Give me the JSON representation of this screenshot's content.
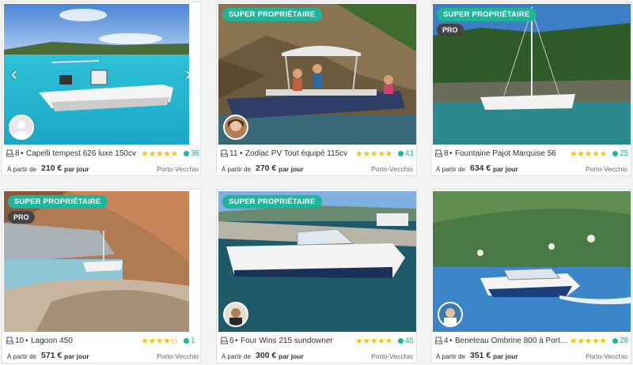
{
  "listings": [
    {
      "capacity": "8",
      "name": "Capelli tempest 626 luxe 150cv",
      "stars": "★★★★★",
      "reviews": "38",
      "price_prefix": "À partir de",
      "price": "210 €",
      "price_suffix": "par jour",
      "city": "Porto-Vecchio",
      "super": "",
      "pro": "",
      "nav_prev": "‹",
      "nav_next": "›"
    },
    {
      "capacity": "11",
      "name": "Zodiac PV Tout équipé 115cv",
      "stars": "★★★★★",
      "reviews": "41",
      "price_prefix": "À partir de",
      "price": "270 €",
      "price_suffix": "par jour",
      "city": "Porto-Vecchio",
      "super": "SUPER PROPRIÉTAIRE",
      "pro": ""
    },
    {
      "capacity": "8",
      "name": "Fountaine Pajot Marquise 56",
      "stars": "★★★★★",
      "reviews": "25",
      "price_prefix": "À partir de",
      "price": "634 €",
      "price_suffix": "par jour",
      "city": "Porto-Vecchio",
      "super": "SUPER PROPRIÉTAIRE",
      "pro": "PRO"
    },
    {
      "capacity": "10",
      "name": "Lagoon 450",
      "stars": "★★★★½",
      "reviews": "1",
      "price_prefix": "À partir de",
      "price": "571 €",
      "price_suffix": "par jour",
      "city": "Porto-Vecchio",
      "super": "SUPER PROPRIÉTAIRE",
      "pro": "PRO"
    },
    {
      "capacity": "6",
      "name": "Four Wins 215 sundowner",
      "stars": "★★★★★",
      "reviews": "45",
      "price_prefix": "À partir de",
      "price": "300 €",
      "price_suffix": "par jour",
      "city": "Porto-Vecchio",
      "super": "SUPER PROPRIÉTAIRE",
      "pro": ""
    },
    {
      "capacity": "4",
      "name": "Beneteau Ombrine 800 à Porto-V...",
      "stars": "★★★★★",
      "reviews": "28",
      "price_prefix": "À partir de",
      "price": "351 €",
      "price_suffix": "par jour",
      "city": "Porto-Vecchio",
      "super": "",
      "pro": ""
    }
  ],
  "separator": "•",
  "colors": {
    "accent": "#1fb59a",
    "star": "#f1c40f",
    "pro": "#444444"
  }
}
